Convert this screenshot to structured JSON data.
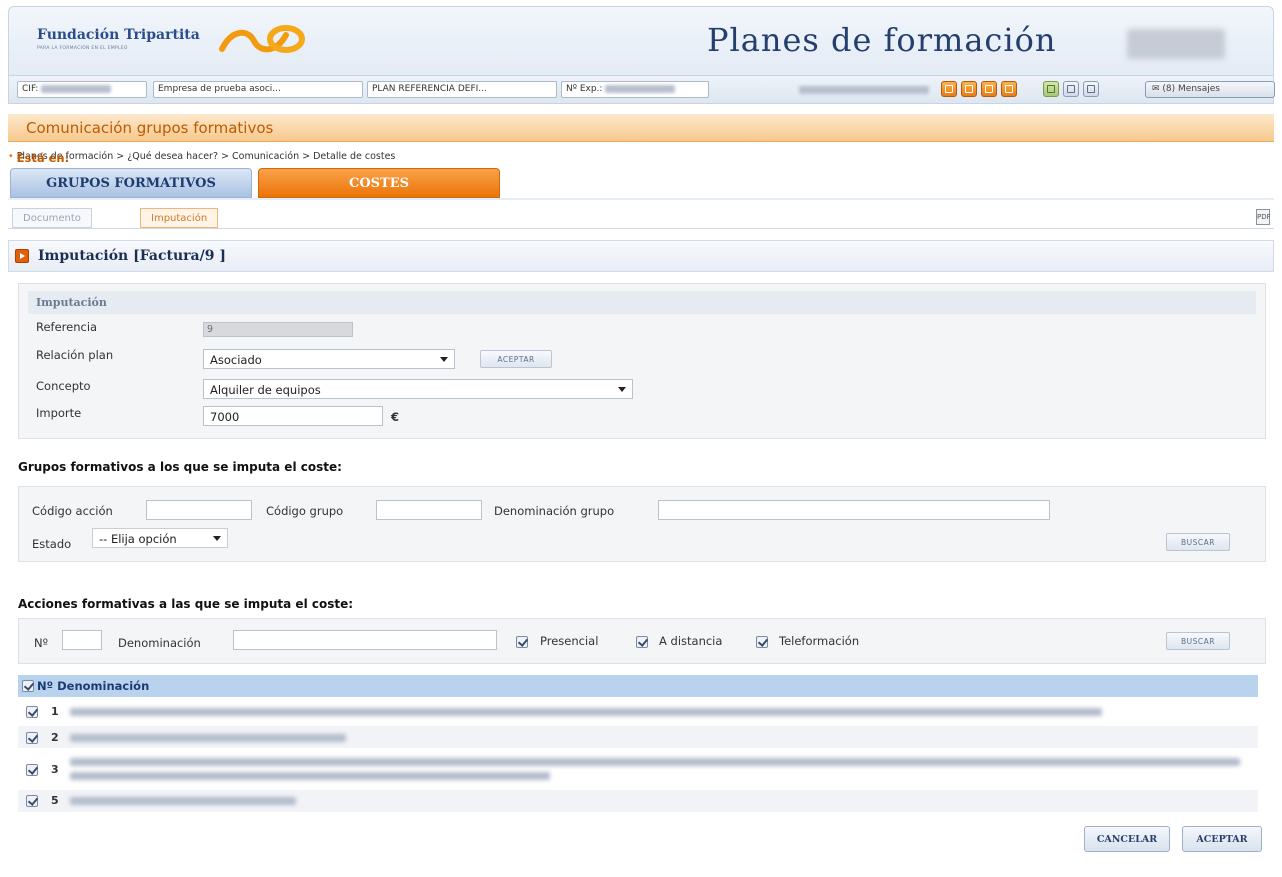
{
  "header": {
    "org_name": "Fundación Tripartita",
    "org_tagline": "PARA LA FORMACIÓN EN EL EMPLEO",
    "app_title": "Planes de formación"
  },
  "infobar": {
    "cif_label": "CIF:",
    "company": "Empresa de prueba asoci...",
    "plan": "PLAN REFERENCIA DEFI...",
    "exp_label": "Nº Exp.:",
    "messages": "(8) Mensajes"
  },
  "section_title": "Comunicación grupos formativos",
  "breadcrumb": {
    "label": "Está en:",
    "path": "Planes de formación > ¿Qué desea hacer? > Comunicación > Detalle de costes"
  },
  "main_tabs": [
    {
      "label": "GRUPOS FORMATIVOS"
    },
    {
      "label": "COSTES"
    }
  ],
  "sub_tabs": [
    {
      "label": "Documento"
    },
    {
      "label": "Imputación"
    }
  ],
  "imputacion_title": "Imputación [Factura/9 ]",
  "form": {
    "header": "Imputación",
    "referencia_label": "Referencia",
    "referencia_value": "9",
    "relacion_label": "Relación plan",
    "relacion_value": "Asociado",
    "aceptar_small": "ACEPTAR",
    "concepto_label": "Concepto",
    "concepto_value": "Alquiler de equipos",
    "importe_label": "Importe",
    "importe_value": "7000",
    "currency": "€"
  },
  "grupos": {
    "title": "Grupos formativos a los que se imputa el coste:",
    "codigo_accion_label": "Código acción",
    "codigo_grupo_label": "Código grupo",
    "denominacion_grupo_label": "Denominación grupo",
    "estado_label": "Estado",
    "estado_value": "-- Elija opción",
    "buscar": "BUSCAR"
  },
  "acciones": {
    "title": "Acciones formativas a las que se imputa el coste:",
    "num_label": "Nº",
    "denominacion_label": "Denominación",
    "presencial": "Presencial",
    "a_distancia": "A distancia",
    "teleformacion": "Teleformación",
    "buscar": "BUSCAR"
  },
  "table": {
    "header": "Nº Denominación",
    "rows": [
      {
        "num": "1"
      },
      {
        "num": "2"
      },
      {
        "num": "3"
      },
      {
        "num": "5"
      }
    ]
  },
  "buttons": {
    "cancelar": "CANCELAR",
    "aceptar": "ACEPTAR"
  }
}
